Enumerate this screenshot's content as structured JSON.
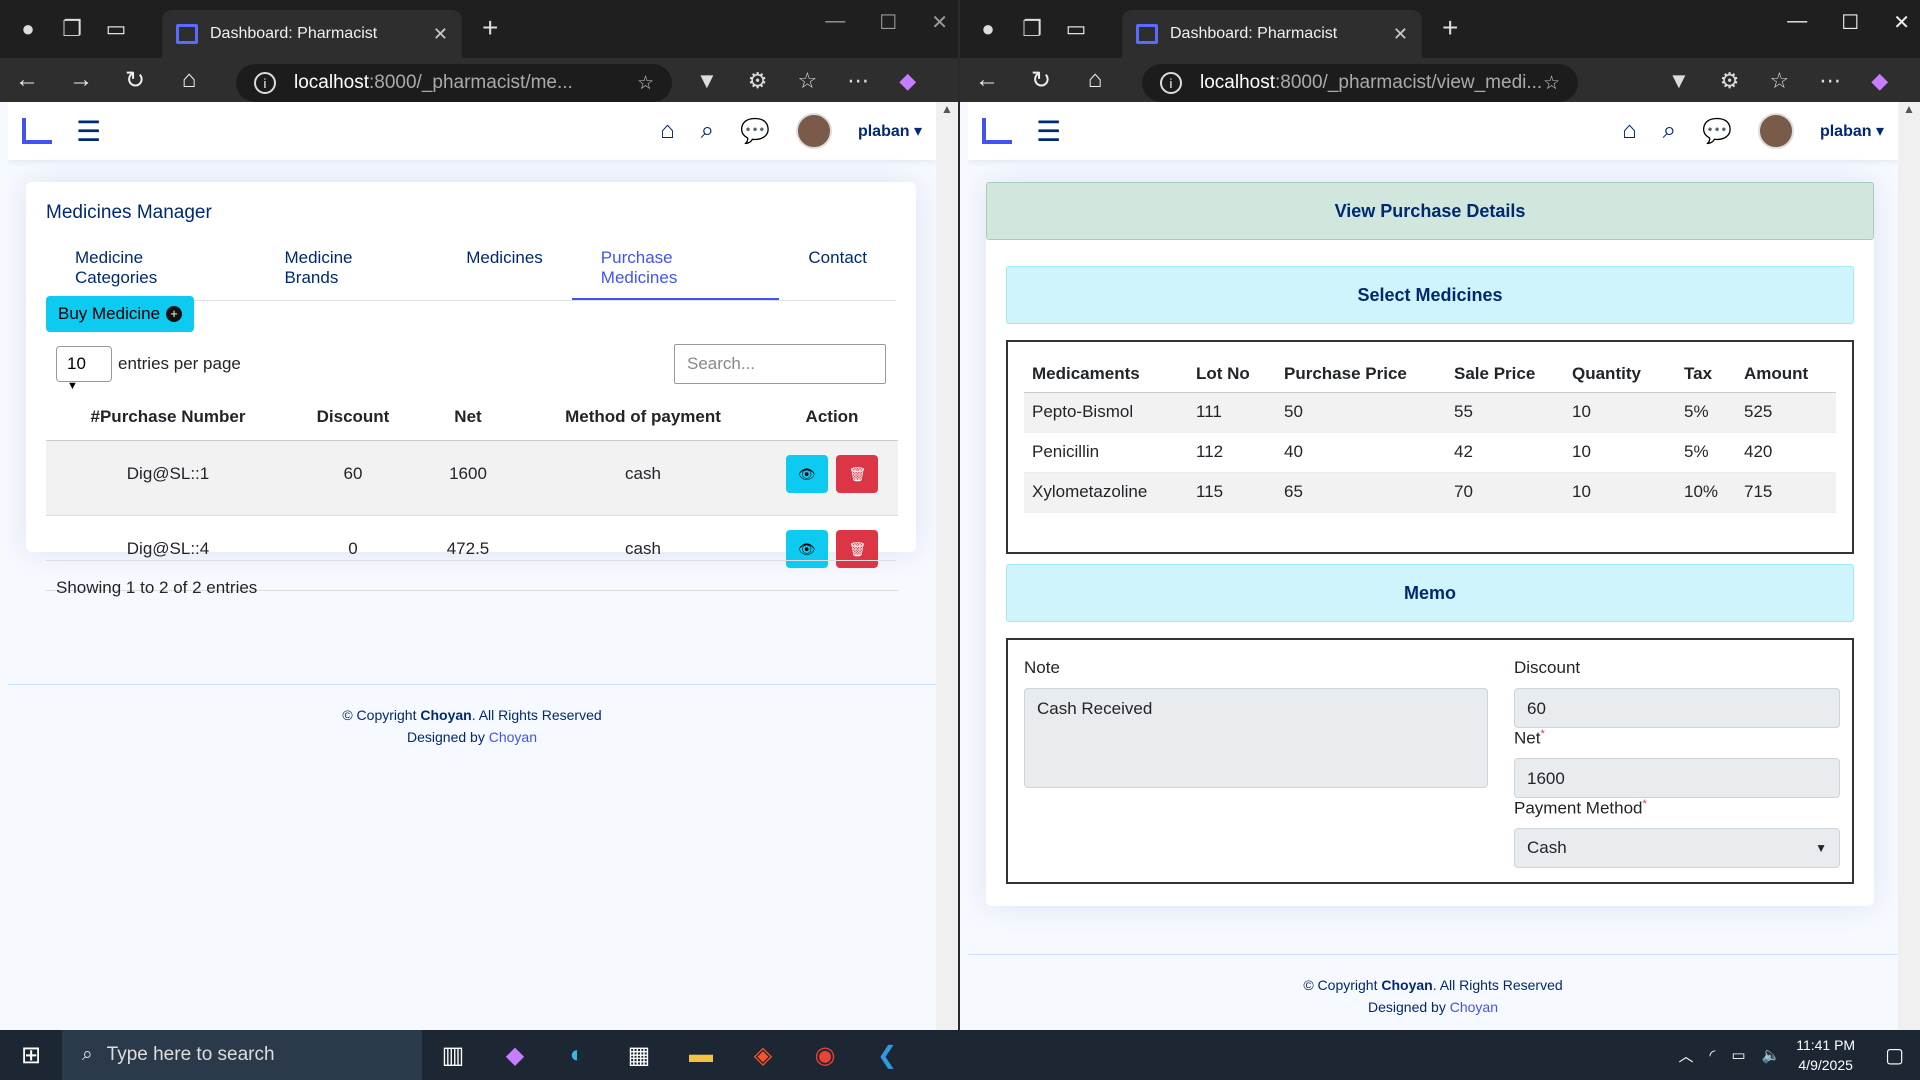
{
  "left": {
    "tab_title": "Dashboard: Pharmacist",
    "url_host": "localhost",
    "url_rest": ":8000/_pharmacist/me...",
    "user": "plaban",
    "card_title": "Medicines Manager",
    "tabs": [
      "Medicine Categories",
      "Medicine Brands",
      "Medicines",
      "Purchase Medicines",
      "Contact"
    ],
    "buy_label": "Buy Medicine",
    "entries_value": "10",
    "entries_label": "entries per page",
    "search_placeholder": "Search...",
    "columns": [
      "#Purchase Number",
      "Discount",
      "Net",
      "Method of payment",
      "Action"
    ],
    "rows": [
      {
        "number": "Dig@SL::1",
        "discount": "60",
        "net": "1600",
        "method": "cash"
      },
      {
        "number": "Dig@SL::4",
        "discount": "0",
        "net": "472.5",
        "method": "cash"
      }
    ],
    "info": "Showing 1 to 2 of 2 entries",
    "footer": {
      "copy_prefix": "© Copyright ",
      "brand": "Choyan",
      "copy_suffix": ". All Rights Reserved",
      "designed_prefix": "Designed by ",
      "designer": "Choyan"
    }
  },
  "right": {
    "tab_title": "Dashboard: Pharmacist",
    "url_host": "localhost",
    "url_rest": ":8000/_pharmacist/view_medi...",
    "user": "plaban",
    "header_title": "View Purchase Details",
    "select_title": "Select Medicines",
    "columns": [
      "Medicaments",
      "Lot No",
      "Purchase Price",
      "Sale Price",
      "Quantity",
      "Tax",
      "Amount"
    ],
    "rows": [
      [
        "Pepto-Bismol",
        "111",
        "50",
        "55",
        "10",
        "5%",
        "525"
      ],
      [
        "Penicillin",
        "112",
        "40",
        "42",
        "10",
        "5%",
        "420"
      ],
      [
        "Xylometazoline",
        "115",
        "65",
        "70",
        "10",
        "10%",
        "715"
      ]
    ],
    "memo_title": "Memo",
    "note_label": "Note",
    "note_value": "Cash Received",
    "discount_label": "Discount",
    "discount_value": "60",
    "net_label": "Net",
    "net_value": "1600",
    "payment_label": "Payment Method",
    "payment_value": "Cash",
    "required_mark": "*",
    "footer": {
      "copy_prefix": "© Copyright ",
      "brand": "Choyan",
      "copy_suffix": ". All Rights Reserved",
      "designed_prefix": "Designed by ",
      "designer": "Choyan"
    }
  },
  "taskbar": {
    "search_placeholder": "Type here to search",
    "time": "11:41 PM",
    "date": "4/9/2025"
  },
  "colors": {
    "accent": "#4154f1",
    "navy": "#012970",
    "info": "#0dcaf0",
    "danger": "#dc3545",
    "success_bg": "#d1e7dd",
    "info_bg": "#cff4fc"
  }
}
